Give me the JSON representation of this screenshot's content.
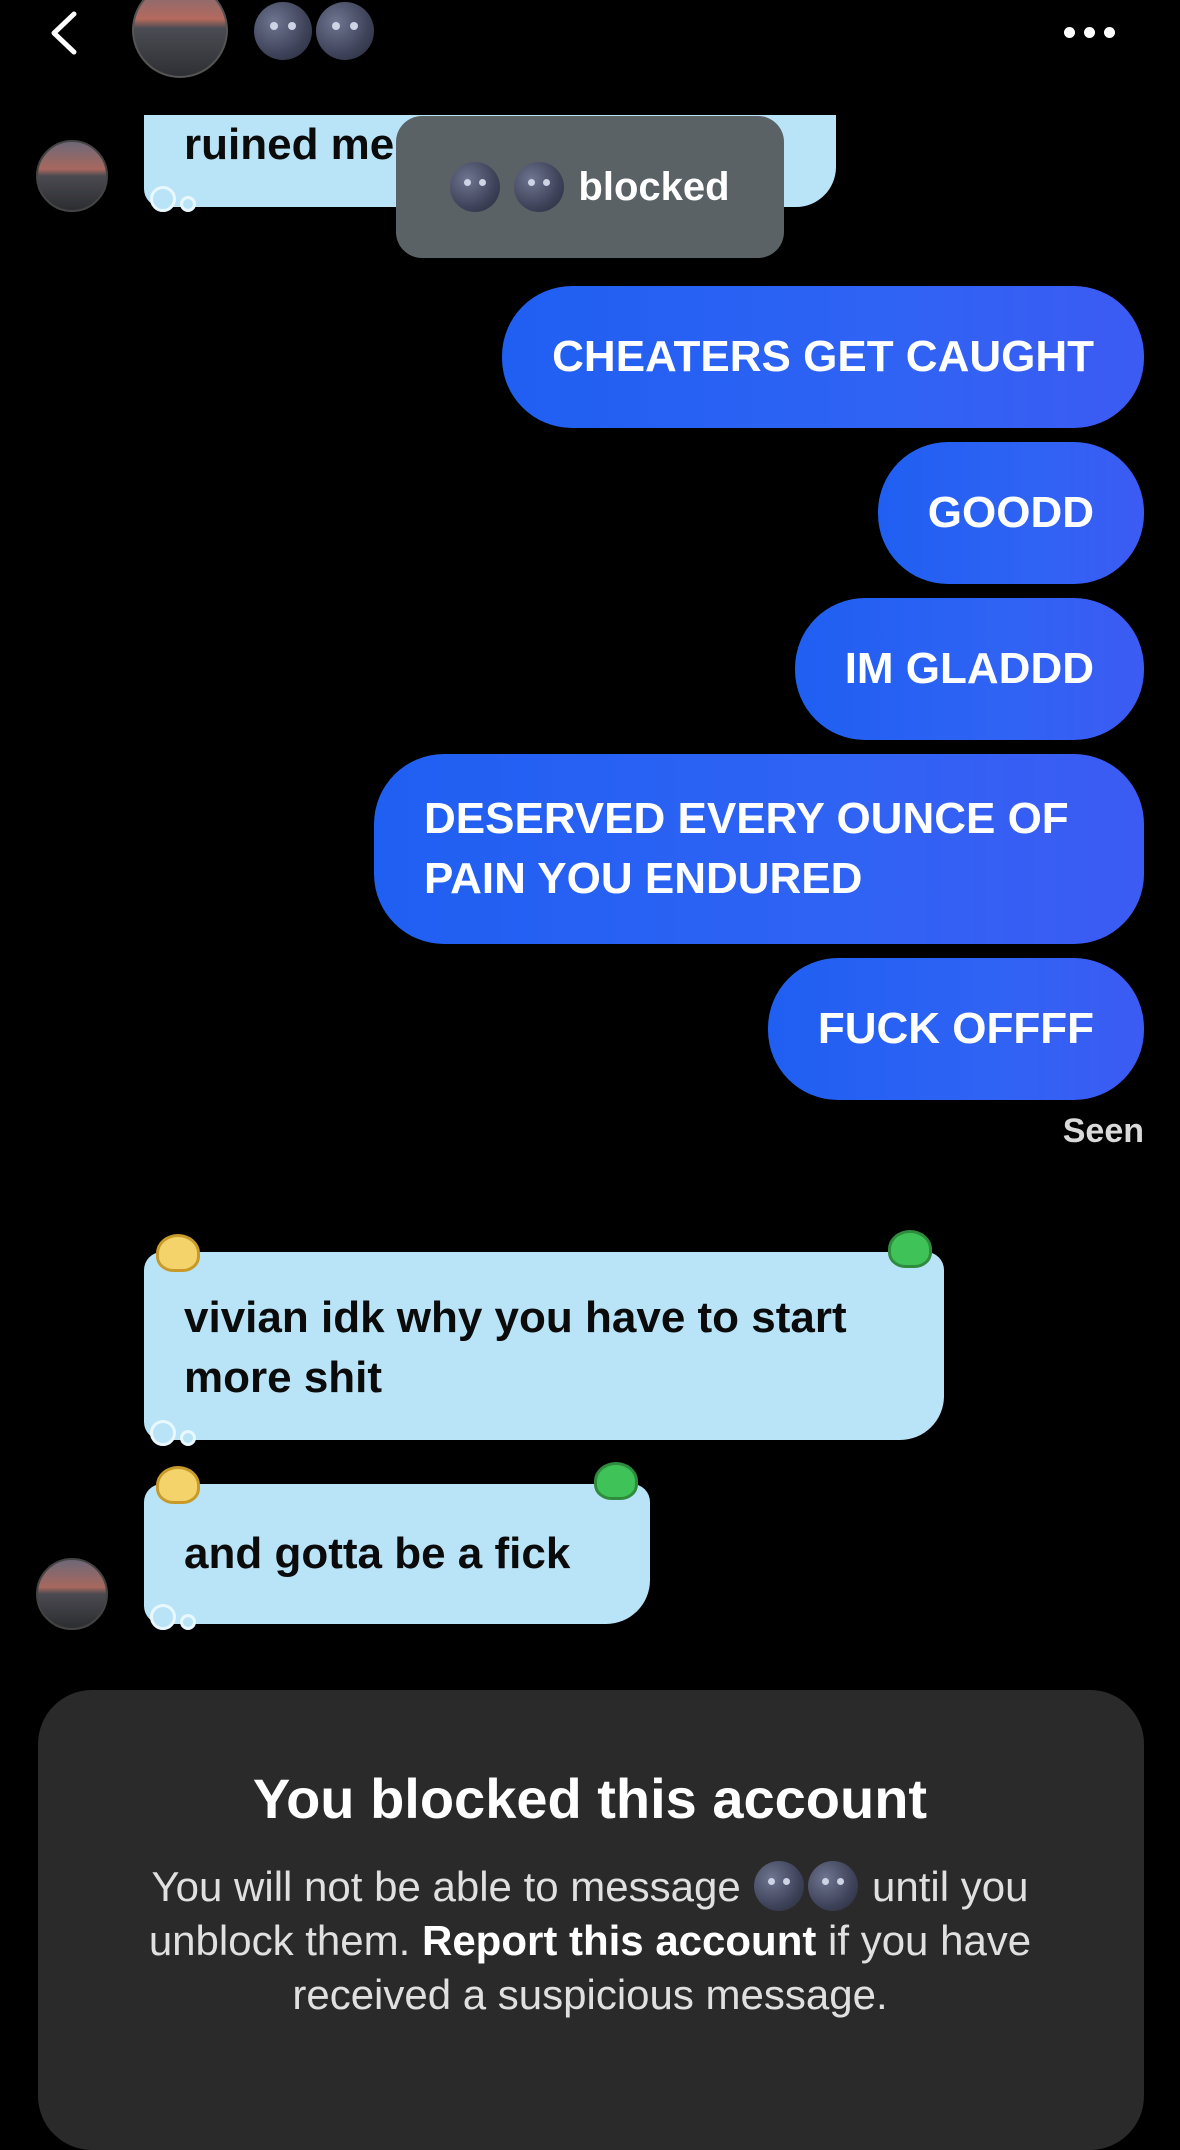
{
  "header": {
    "back_icon": "chevron-left-icon",
    "contact_avatar": "avatar",
    "contact_name_emojis": [
      "new-moon-face-icon",
      "new-moon-face-icon"
    ],
    "more_icon": "ellipsis-icon"
  },
  "toast": {
    "label": "blocked"
  },
  "messages": [
    {
      "side": "incoming",
      "text": "ruined me"
    },
    {
      "side": "outgoing",
      "text": "CHEATERS GET CAUGHT"
    },
    {
      "side": "outgoing",
      "text": "GOODD"
    },
    {
      "side": "outgoing",
      "text": "IM GLADDD"
    },
    {
      "side": "outgoing",
      "text": "DESERVED EVERY OUNCE OF PAIN YOU ENDURED"
    },
    {
      "side": "outgoing",
      "text": "FUCK OFFFF"
    },
    {
      "side": "incoming",
      "text": "vivian idk why you have to start more shit"
    },
    {
      "side": "incoming",
      "text": "and gotta be a fick"
    }
  ],
  "status": {
    "seen": "Seen"
  },
  "blocked_notice": {
    "title": "You blocked this account",
    "body_part1": "You will not be able to message",
    "body_part2": "until you unblock them.",
    "report_link": "Report this account",
    "body_part3": "if you have received a suspicious message."
  },
  "colors": {
    "incoming_bubble": "#b9e4f7",
    "outgoing_bubble": "#2f63f4",
    "panel": "#2a2a2a"
  }
}
